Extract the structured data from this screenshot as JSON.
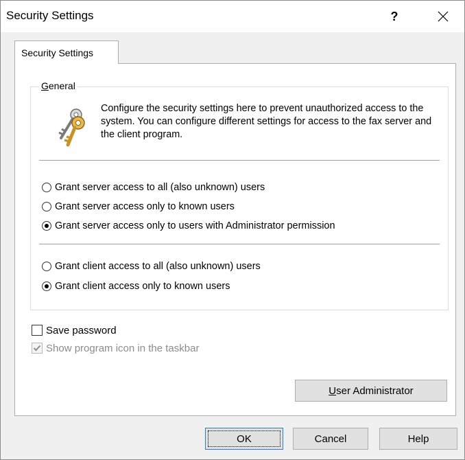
{
  "window": {
    "title": "Security Settings",
    "help_label": "?",
    "close_icon": "close-icon"
  },
  "tabs": [
    {
      "label": "Security Settings",
      "selected": true
    }
  ],
  "general_group": {
    "label_accel": "G",
    "label_rest": "eneral",
    "icon": "keys-icon",
    "description": "Configure the security settings here to prevent unauthorized access to the system. You can configure different settings for access to the fax server and the client program."
  },
  "server_access": {
    "options": [
      {
        "label": "Grant server access to all (also unknown) users",
        "selected": false
      },
      {
        "label": "Grant server access only to known users",
        "selected": false
      },
      {
        "label": "Grant server access only to users with Administrator permission",
        "selected": true
      }
    ]
  },
  "client_access": {
    "options": [
      {
        "label": "Grant client access to all (also unknown) users",
        "selected": false
      },
      {
        "label": "Grant client access only to known users",
        "selected": true
      }
    ]
  },
  "checkboxes": {
    "save_password": {
      "label": "Save password",
      "checked": false,
      "enabled": true
    },
    "show_icon": {
      "label": "Show program icon in the taskbar",
      "checked": true,
      "enabled": false
    }
  },
  "buttons": {
    "user_admin_accel": "U",
    "user_admin_rest": "ser Administrator",
    "ok": "OK",
    "cancel": "Cancel",
    "help": "Help"
  },
  "colors": {
    "window_bg": "#f0f0f0",
    "panel_bg": "#ffffff",
    "focus_border": "#2b7bd3"
  }
}
